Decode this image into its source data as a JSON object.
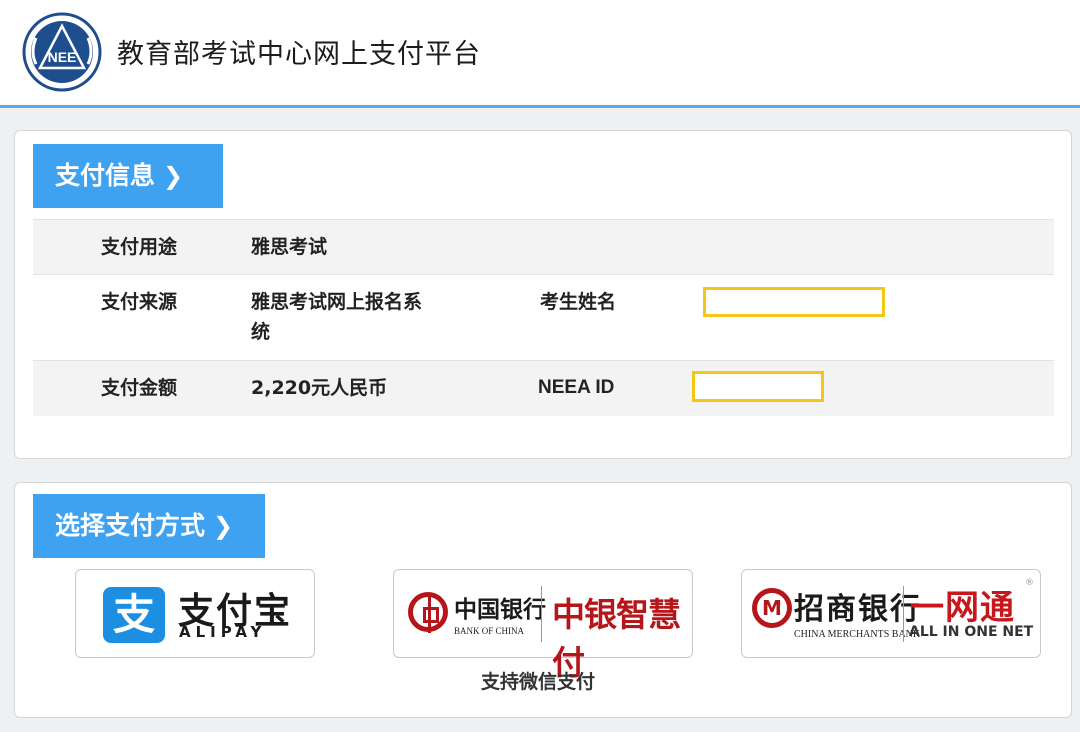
{
  "header": {
    "site_title": "教育部考试中心网上支付平台",
    "logo_text": "NEE",
    "logo_icon": "neea-emblem-icon"
  },
  "payment_info": {
    "section_title": "支付信息",
    "chevron_icon": "chevron-right-icon",
    "rows": [
      {
        "label": "支付用途",
        "value": "雅思考试"
      },
      {
        "label": "支付来源",
        "value_line1": "雅思考试网上报名系",
        "value_line2": "统",
        "extra_label": "考生姓名",
        "extra_value": ""
      },
      {
        "label": "支付金额",
        "value": "2,220元人民币",
        "extra_label": "NEEA ID",
        "extra_value": ""
      }
    ],
    "redaction_color": "#f5c518"
  },
  "payment_method": {
    "section_title": "选择支付方式",
    "alipay": {
      "icon_char": "支",
      "name_cn": "支付宝",
      "name_en": "ALIPAY"
    },
    "boc": {
      "name_cn": "中国银行",
      "name_en": "BANK OF CHINA",
      "brand": "中银智慧付"
    },
    "cmb": {
      "name_cn": "招商银行",
      "name_en": "CHINA MERCHANTS BANK",
      "brand": "一网通",
      "brand_en": "ALL IN ONE NET",
      "registered": "®"
    },
    "wechat_note": "支持微信支付"
  },
  "colors": {
    "accent": "#3ea2f1",
    "header_border": "#5aa8e6",
    "bank_red": "#b5161a",
    "alipay_blue": "#1d8fe3"
  }
}
